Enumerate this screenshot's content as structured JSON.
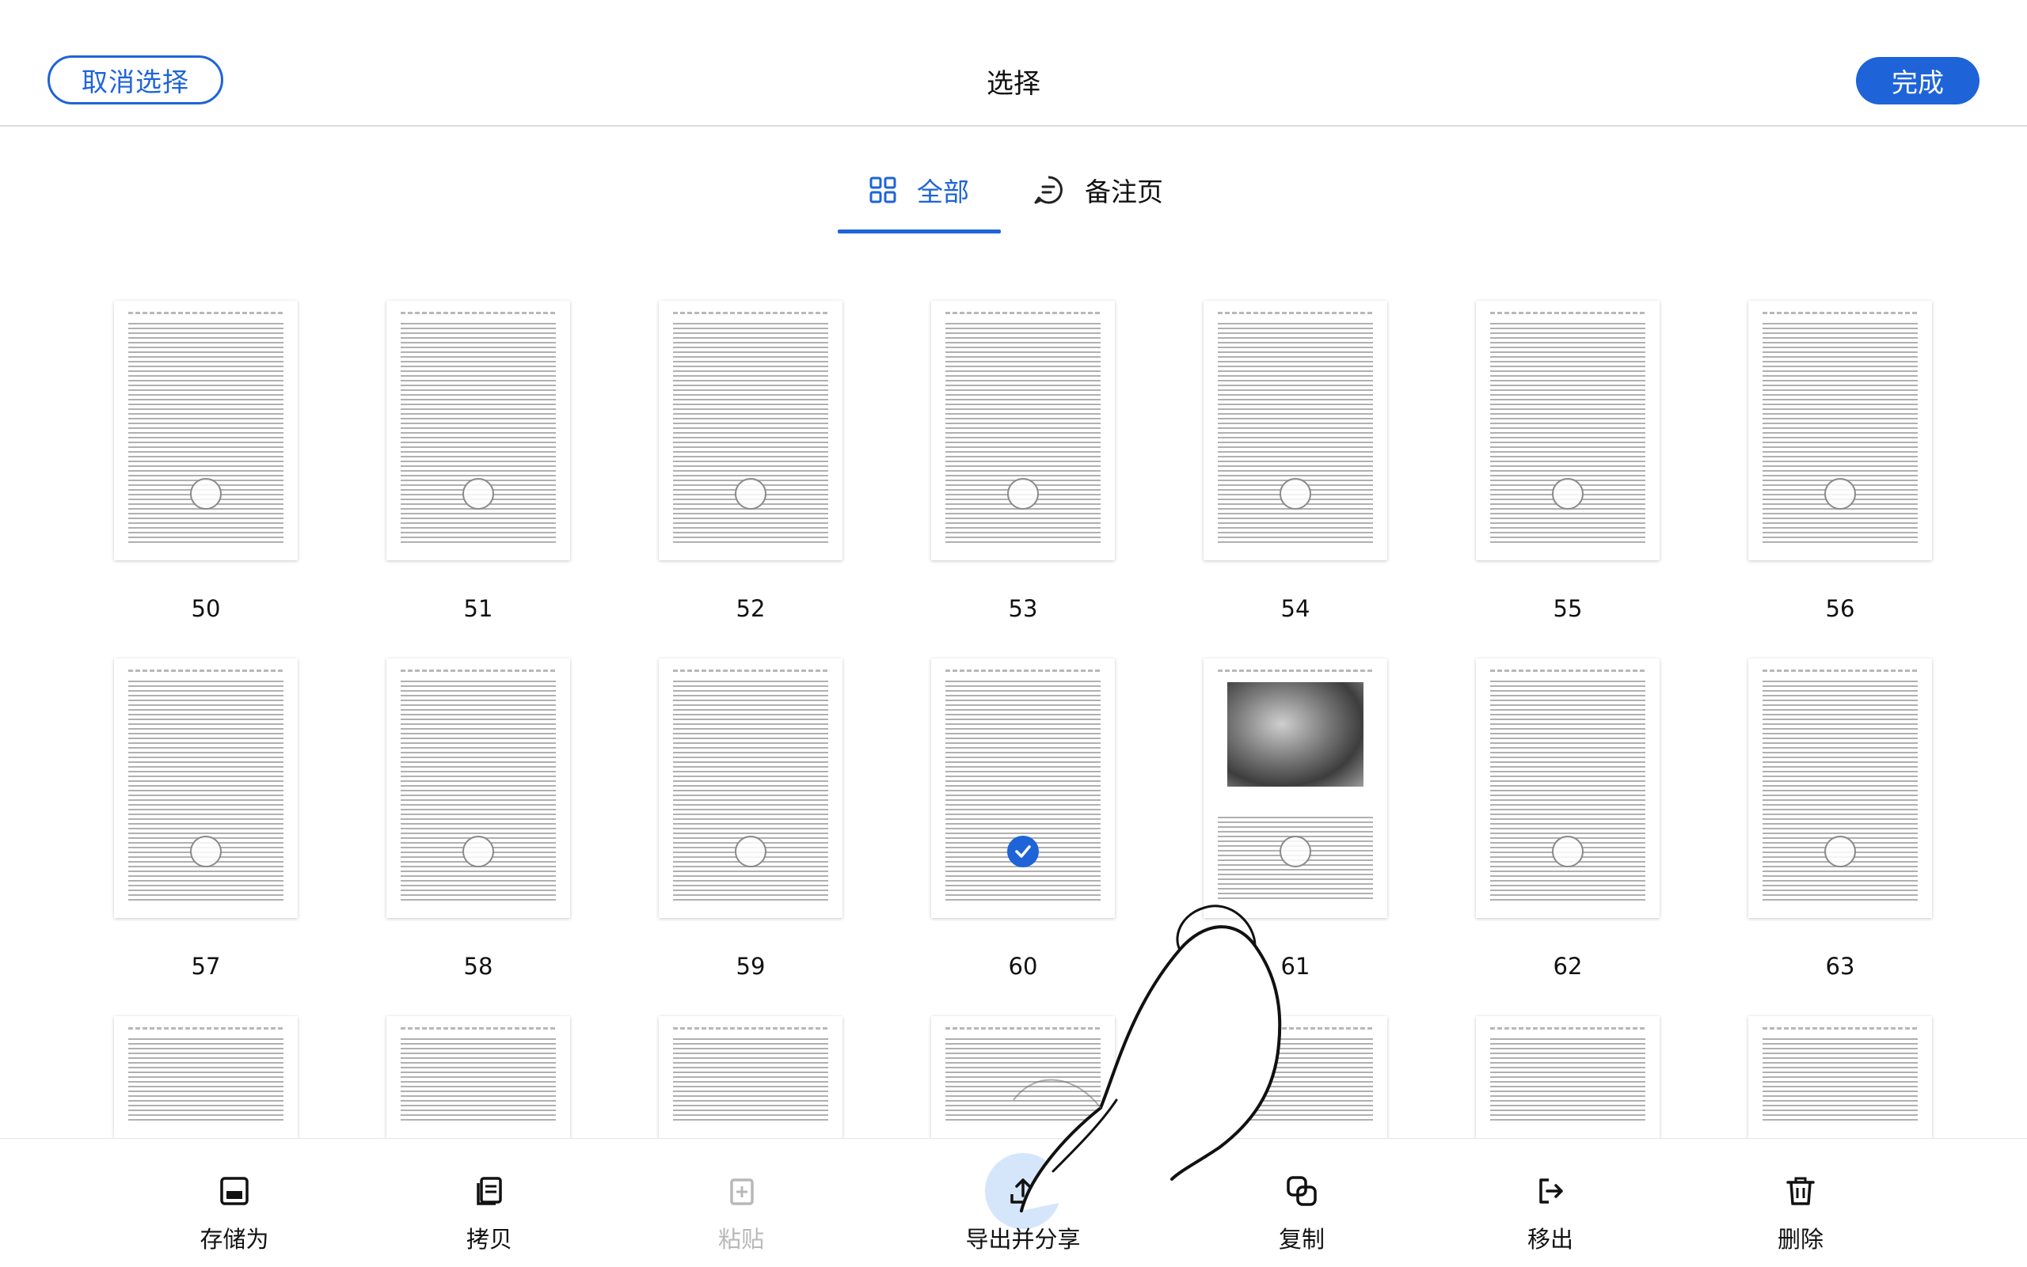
{
  "header": {
    "cancel_label": "取消选择",
    "title": "选择",
    "done_label": "完成"
  },
  "tabs": [
    {
      "label": "全部",
      "icon": "grid-icon",
      "active": true
    },
    {
      "label": "备注页",
      "icon": "comment-icon",
      "active": false
    }
  ],
  "pages": [
    {
      "number": "50",
      "selected": false
    },
    {
      "number": "51",
      "selected": false
    },
    {
      "number": "52",
      "selected": false
    },
    {
      "number": "53",
      "selected": false
    },
    {
      "number": "54",
      "selected": false
    },
    {
      "number": "55",
      "selected": false
    },
    {
      "number": "56",
      "selected": false
    },
    {
      "number": "57",
      "selected": false
    },
    {
      "number": "58",
      "selected": false
    },
    {
      "number": "59",
      "selected": false
    },
    {
      "number": "60",
      "selected": true
    },
    {
      "number": "61",
      "selected": false
    },
    {
      "number": "62",
      "selected": false
    },
    {
      "number": "63",
      "selected": false
    }
  ],
  "toolbar": {
    "save_as": "存储为",
    "copy": "拷贝",
    "paste": "粘贴",
    "export_share": "导出并分享",
    "duplicate": "复制",
    "move_out": "移出",
    "delete": "删除"
  },
  "colors": {
    "accent": "#1e64d8",
    "active_tool_bg": "#d5e6fb",
    "disabled_text": "#b8b8b8"
  }
}
